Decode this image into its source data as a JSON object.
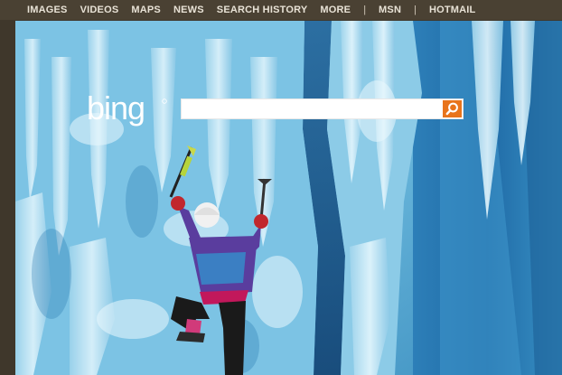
{
  "nav": {
    "items": [
      "IMAGES",
      "VIDEOS",
      "MAPS",
      "NEWS",
      "SEARCH HISTORY",
      "MORE"
    ],
    "separator": "|",
    "msn": "MSN",
    "hotmail": "HOTMAIL"
  },
  "logo": {
    "text": "bing"
  },
  "search": {
    "value": "",
    "placeholder": ""
  },
  "colors": {
    "topbar": "#4a4133",
    "nav_text": "#e8e2d6",
    "search_button": "#e8741c",
    "ice": "#7ec3e3",
    "jacket": "#5a3d9e"
  },
  "icons": {
    "search_button": "search-icon"
  }
}
